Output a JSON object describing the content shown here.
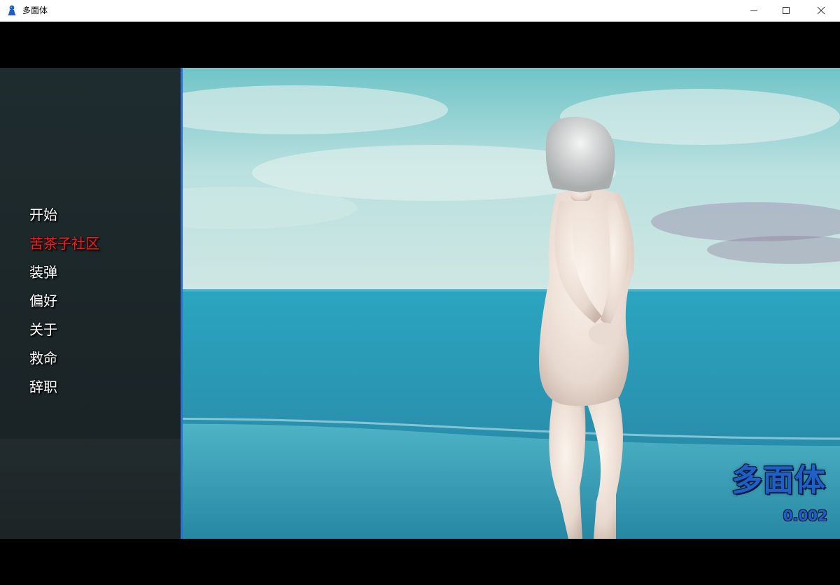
{
  "window": {
    "title": "多面体",
    "icon": "pawn-icon",
    "buttons": {
      "minimize": "minimize-icon",
      "maximize": "maximize-icon",
      "close": "close-icon"
    }
  },
  "menu": {
    "items": [
      {
        "label": "开始",
        "active": false
      },
      {
        "label": "苦茶子社区",
        "active": true
      },
      {
        "label": "装弹",
        "active": false
      },
      {
        "label": "偏好",
        "active": false
      },
      {
        "label": "关于",
        "active": false
      },
      {
        "label": "救命",
        "active": false
      },
      {
        "label": "辞职",
        "active": false
      }
    ]
  },
  "game": {
    "title": "多面体",
    "version": "0.002"
  },
  "colors": {
    "accent": "#2f6fd6",
    "logo": "#1e5fc8",
    "active_menu": "#ff1a1a",
    "menu_text": "#ffffff"
  }
}
